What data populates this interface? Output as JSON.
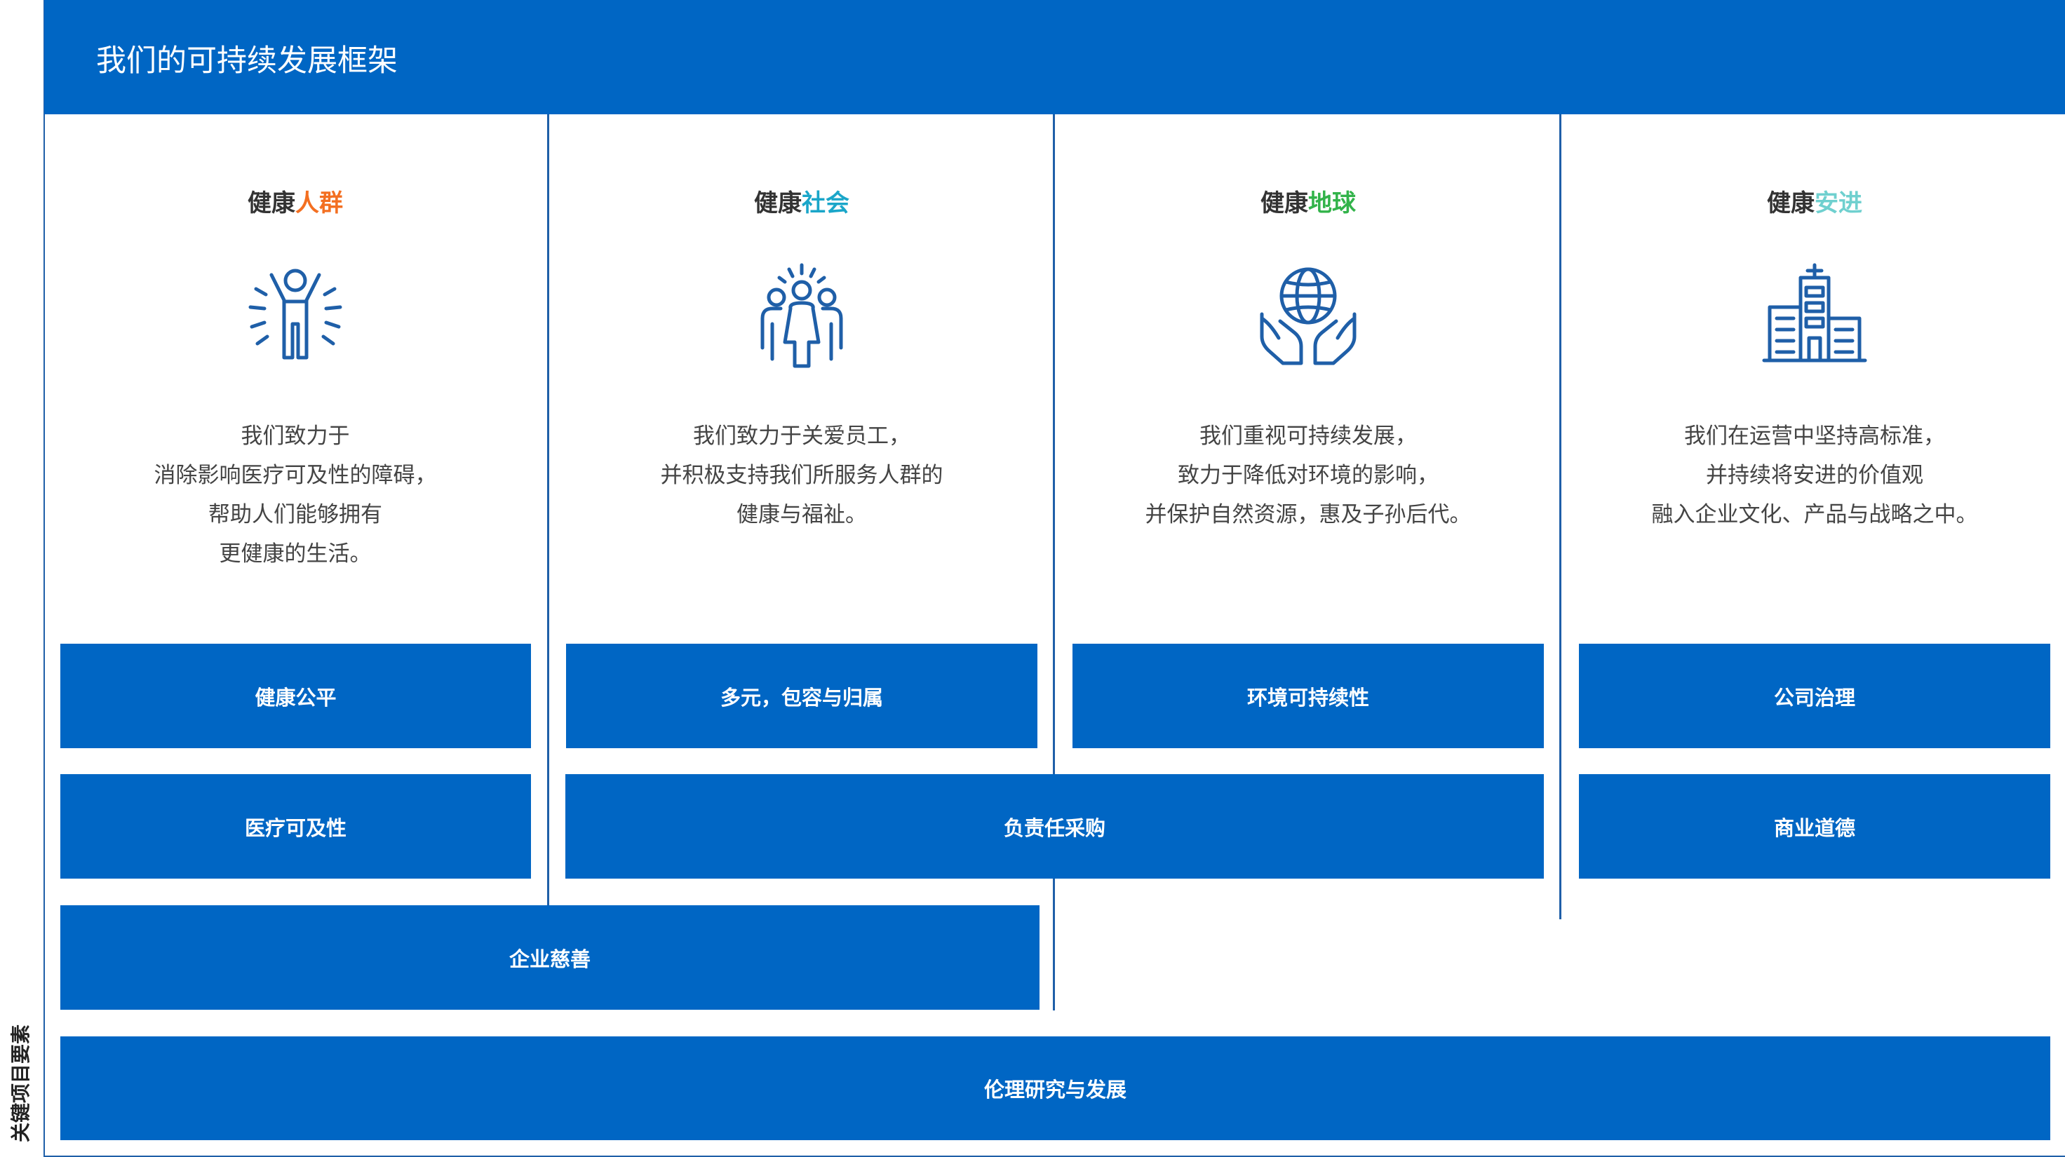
{
  "header": {
    "title": "我们的可持续发展框架"
  },
  "side_label": "关键项目要素",
  "colors": {
    "brand_blue": "#0066c4",
    "divider": "#1f5fa8",
    "accent_people": "#f36f21",
    "accent_society": "#1aa6c9",
    "accent_planet": "#32b34a",
    "accent_progress": "#6fd0cf"
  },
  "columns": [
    {
      "title_prefix": "健康",
      "title_accent": "人群",
      "icon": "person-cheering-icon",
      "desc": [
        "我们致力于",
        "消除影响医疗可及性的障碍，",
        "帮助人们能够拥有",
        "更健康的生活。"
      ]
    },
    {
      "title_prefix": "健康",
      "title_accent": "社会",
      "icon": "people-group-icon",
      "desc": [
        "我们致力于关爱员工，",
        "并积极支持我们所服务人群的",
        "健康与福祉。"
      ]
    },
    {
      "title_prefix": "健康",
      "title_accent": "地球",
      "icon": "globe-in-hands-icon",
      "desc": [
        "我们重视可持续发展，",
        "致力于降低对环境的影响，",
        "并保护自然资源，惠及子孙后代。"
      ]
    },
    {
      "title_prefix": "健康",
      "title_accent": "安进",
      "icon": "office-buildings-icon",
      "desc": [
        "我们在运营中坚持高标准，",
        "并持续将安进的价值观",
        "融入企业文化、产品与战略之中。"
      ]
    }
  ],
  "key_elements": {
    "health_equity": "健康公平",
    "dei": "多元，包容与归属",
    "env_sustainability": "环境可持续性",
    "corporate_governance": "公司治理",
    "access_to_care": "医疗可及性",
    "responsible_sourcing": "负责任采购",
    "business_ethics": "商业道德",
    "philanthropy": "企业慈善",
    "ethical_rd": "伦理研究与发展"
  }
}
